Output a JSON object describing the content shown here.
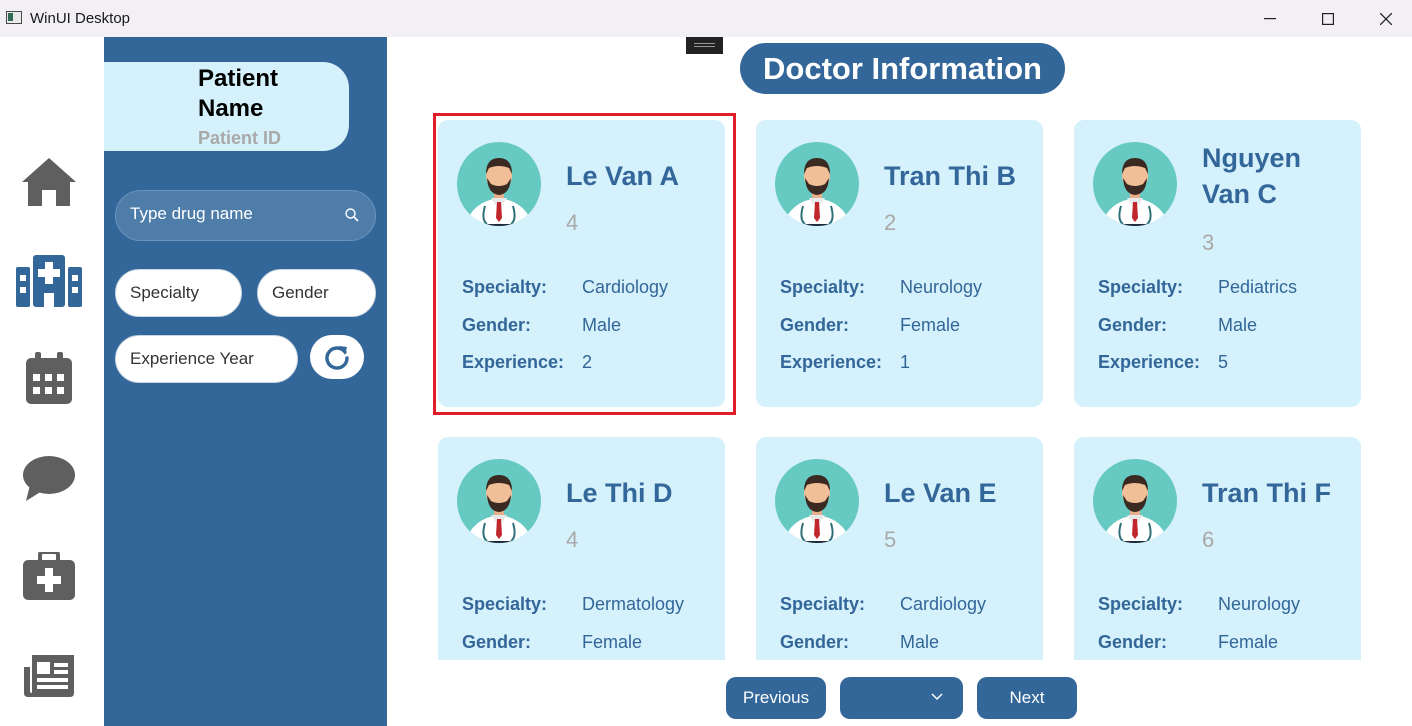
{
  "window": {
    "title": "WinUI Desktop"
  },
  "rail": {
    "items": [
      {
        "icon": "home-icon"
      },
      {
        "icon": "hospital-icon"
      },
      {
        "icon": "calendar-icon"
      },
      {
        "icon": "chat-icon"
      },
      {
        "icon": "medical-kit-icon"
      },
      {
        "icon": "newspaper-icon"
      }
    ]
  },
  "patient": {
    "name": "Patient Name",
    "id": "Patient ID"
  },
  "filters": {
    "search_placeholder": "Type drug name",
    "specialty_placeholder": "Specialty",
    "gender_placeholder": "Gender",
    "experience_placeholder": "Experience Year"
  },
  "main": {
    "heading": "Doctor Information",
    "labels": {
      "specialty": "Specialty:",
      "gender": "Gender:",
      "experience": "Experience:"
    },
    "doctors": [
      {
        "name": "Le Van A",
        "id": "4",
        "specialty": "Cardiology",
        "gender": "Male",
        "experience": "2",
        "selected": true
      },
      {
        "name": "Tran Thi B",
        "id": "2",
        "specialty": "Neurology",
        "gender": "Female",
        "experience": "1"
      },
      {
        "name": "Nguyen Van C",
        "id": "3",
        "specialty": "Pediatrics",
        "gender": "Male",
        "experience": "5"
      },
      {
        "name": "Le Thi D",
        "id": "4",
        "specialty": "Dermatology",
        "gender": "Female"
      },
      {
        "name": "Le Van E",
        "id": "5",
        "specialty": "Cardiology",
        "gender": "Male"
      },
      {
        "name": "Tran Thi F",
        "id": "6",
        "specialty": "Neurology",
        "gender": "Female"
      }
    ]
  },
  "pager": {
    "previous": "Previous",
    "next": "Next",
    "page_value": ""
  },
  "colors": {
    "primary": "#336699",
    "card": "#d5f1fb",
    "selection": "#e11d2a",
    "icon_gray": "#5f5f5f"
  }
}
